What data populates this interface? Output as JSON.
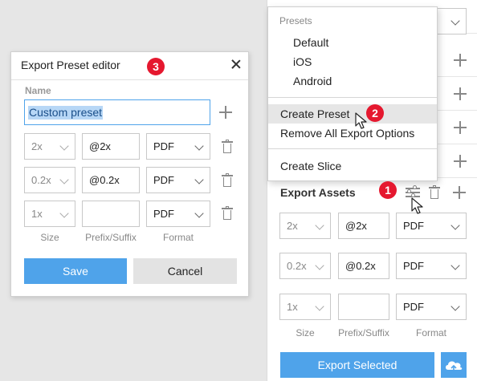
{
  "right_panel": {
    "header_select_chevron": "chevron-down-icon",
    "section_title": "Export Assets",
    "rows": [
      {
        "scale": "2x",
        "suffix": "@2x",
        "format": "PDF"
      },
      {
        "scale": "0.2x",
        "suffix": "@0.2x",
        "format": "PDF"
      },
      {
        "scale": "1x",
        "suffix": "",
        "format": "PDF"
      }
    ],
    "col_size": "Size",
    "col_prefix": "Prefix/Suffix",
    "col_format": "Format",
    "export_button": "Export Selected"
  },
  "menu": {
    "section_label": "Presets",
    "presets": [
      "Default",
      "iOS",
      "Android"
    ],
    "create_preset": "Create Preset",
    "remove_all": "Remove All Export Options",
    "create_slice": "Create Slice"
  },
  "dialog": {
    "title": "Export Preset editor",
    "name_label": "Name",
    "name_value": "Custom preset",
    "rows": [
      {
        "scale": "2x",
        "suffix": "@2x",
        "format": "PDF"
      },
      {
        "scale": "0.2x",
        "suffix": "@0.2x",
        "format": "PDF"
      },
      {
        "scale": "1x",
        "suffix": "",
        "format": "PDF"
      }
    ],
    "col_size": "Size",
    "col_prefix": "Prefix/Suffix",
    "col_format": "Format",
    "save": "Save",
    "cancel": "Cancel"
  },
  "badges": {
    "one": "1",
    "two": "2",
    "three": "3"
  },
  "colors": {
    "accent": "#4fa3ea",
    "badge": "#e5182f"
  }
}
